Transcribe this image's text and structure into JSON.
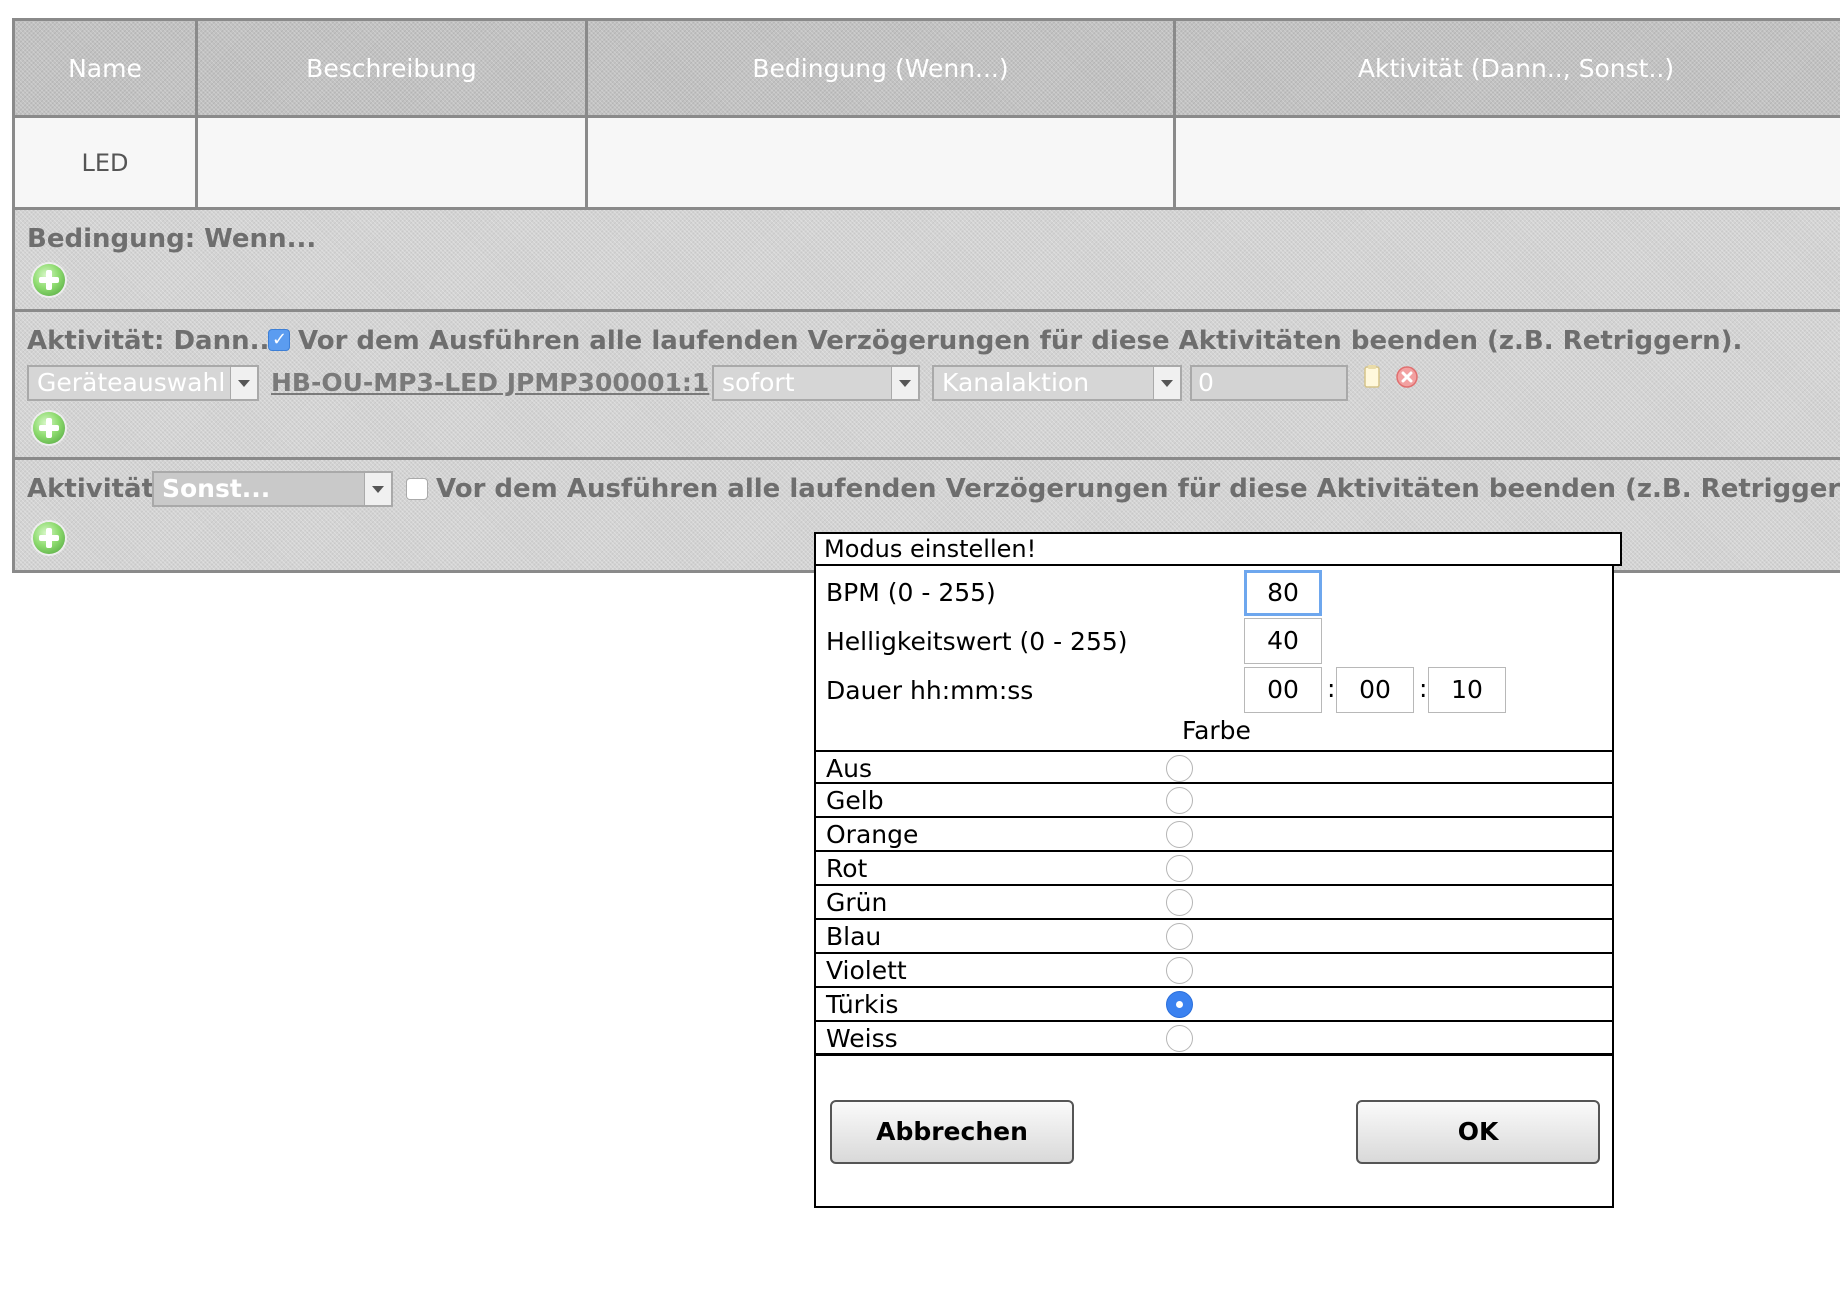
{
  "table": {
    "headers": [
      "Name",
      "Beschreibung",
      "Bedingung (Wenn...)",
      "Aktivität (Dann.., Sonst..)"
    ],
    "row": {
      "name": "LED",
      "description": "",
      "condition": "",
      "activity": ""
    }
  },
  "condition_section": {
    "title": "Bedingung: Wenn...",
    "add_icon": "add-icon"
  },
  "then_section": {
    "title": "Aktivität: Dann...",
    "retrigger_checked": true,
    "retrigger_label": "Vor dem Ausführen alle laufenden Verzögerungen für diese Aktivitäten beenden (z.B. Retriggern).",
    "device_select": "Geräteauswahl",
    "device_link": "HB-OU-MP3-LED JPMP300001:1",
    "timing_select": "sofort",
    "action_select": "Kanalaktion",
    "value": "0"
  },
  "else_section": {
    "title": "Aktivität:",
    "mode_select": "Sonst...",
    "retrigger_checked": false,
    "retrigger_label": "Vor dem Ausführen alle laufenden Verzögerungen für diese Aktivitäten beenden (z.B. Retriggern)."
  },
  "dialog": {
    "title": "Modus einstellen!",
    "bpm_label": "BPM (0 - 255)",
    "bpm_value": "80",
    "brightness_label": "Helligkeitswert (0 - 255)",
    "brightness_value": "40",
    "duration_label": "Dauer hh:mm:ss",
    "duration_hh": "00",
    "duration_mm": "00",
    "duration_ss": "10",
    "color_heading": "Farbe",
    "colors": [
      {
        "label": "Aus",
        "selected": false
      },
      {
        "label": "Gelb",
        "selected": false
      },
      {
        "label": "Orange",
        "selected": false
      },
      {
        "label": "Rot",
        "selected": false
      },
      {
        "label": "Grün",
        "selected": false
      },
      {
        "label": "Blau",
        "selected": false
      },
      {
        "label": "Violett",
        "selected": false
      },
      {
        "label": "Türkis",
        "selected": true
      },
      {
        "label": "Weiss",
        "selected": false
      }
    ],
    "cancel_label": "Abbrechen",
    "ok_label": "OK"
  },
  "colors": {
    "accent": "#3b82f0",
    "panel": "#c2c2c2",
    "border": "#8a8a8a"
  }
}
